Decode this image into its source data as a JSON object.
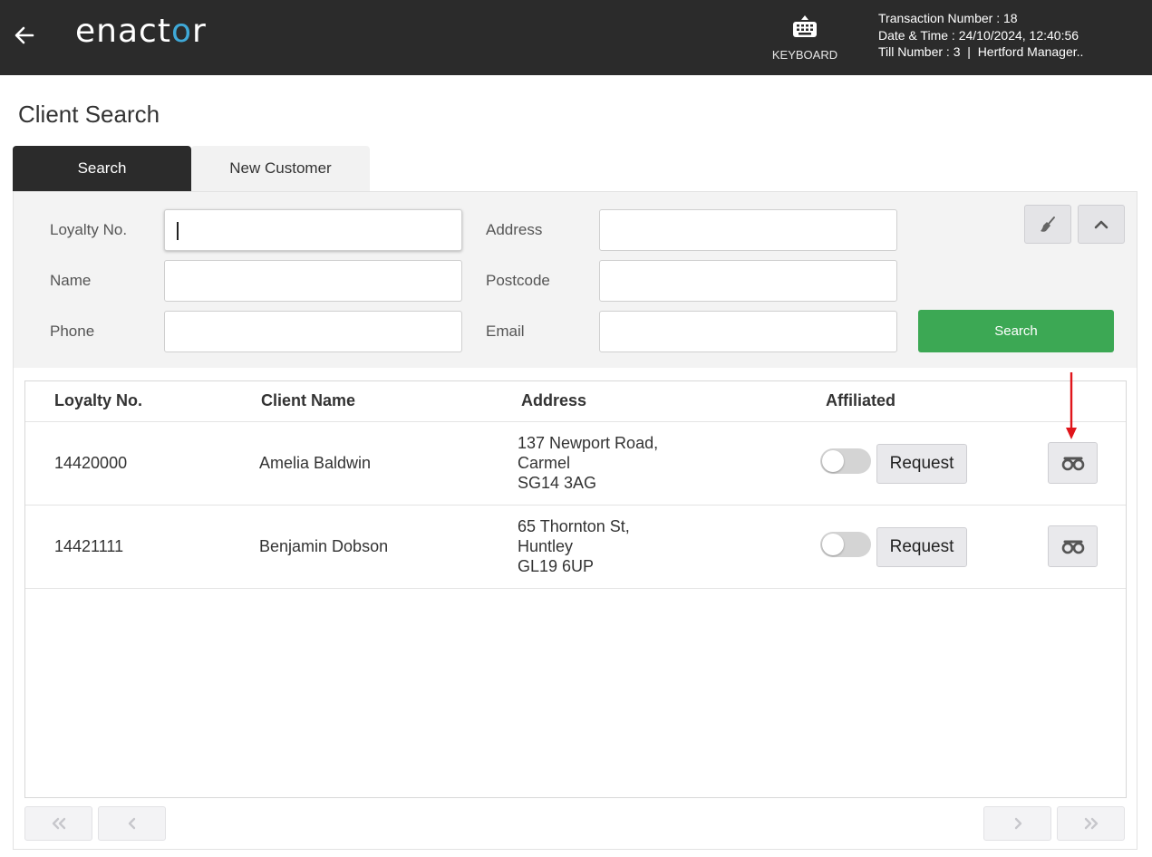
{
  "header": {
    "logo_text_left": "enact",
    "logo_text_o": "o",
    "logo_text_right": "r",
    "keyboard_label": "KEYBOARD",
    "transaction_line": "Transaction Number : 18",
    "datetime_line": "Date & Time : 24/10/2024, 12:40:56",
    "till_line": "Till Number : 3  |  Hertford Manager.."
  },
  "page": {
    "title": "Client Search"
  },
  "tabs": [
    {
      "label": "Search",
      "active": true
    },
    {
      "label": "New Customer",
      "active": false
    }
  ],
  "search_form": {
    "loyalty_label": "Loyalty No.",
    "name_label": "Name",
    "phone_label": "Phone",
    "address_label": "Address",
    "postcode_label": "Postcode",
    "email_label": "Email",
    "loyalty_value": "",
    "name_value": "",
    "phone_value": "",
    "address_value": "",
    "postcode_value": "",
    "email_value": "",
    "search_button": "Search"
  },
  "table": {
    "headers": {
      "loyalty": "Loyalty No.",
      "client_name": "Client Name",
      "address": "Address",
      "affiliated": "Affiliated"
    },
    "rows": [
      {
        "loyalty": "14420000",
        "name": "Amelia Baldwin",
        "address_line1": "137 Newport Road,",
        "address_line2": "Carmel",
        "address_line3": "SG14 3AG",
        "affiliated": false,
        "request_label": "Request"
      },
      {
        "loyalty": "14421111",
        "name": "Benjamin Dobson",
        "address_line1": "65 Thornton St,",
        "address_line2": "Huntley",
        "address_line3": "GL19 6UP",
        "affiliated": false,
        "request_label": "Request"
      }
    ]
  },
  "colors": {
    "header_bg": "#2b2b2b",
    "logo_accent": "#3fa9d8",
    "search_button": "#3ca854",
    "annotation_arrow": "#e0151b"
  },
  "icons": [
    "back-arrow-icon",
    "keyboard-icon",
    "broom-icon",
    "chevron-up-icon",
    "binoculars-icon",
    "first-page-icon",
    "prev-page-icon",
    "next-page-icon",
    "last-page-icon"
  ]
}
